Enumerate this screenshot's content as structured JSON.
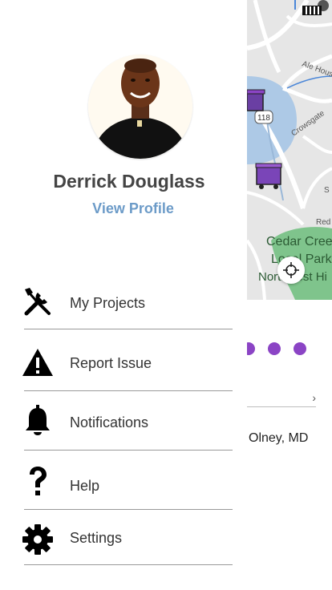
{
  "profile": {
    "name": "Derrick Douglass",
    "view_profile_label": "View Profile"
  },
  "menu": {
    "items": [
      {
        "label": "My Projects",
        "icon": "tools-icon"
      },
      {
        "label": "Report Issue",
        "icon": "warning-icon"
      },
      {
        "label": "Notifications",
        "icon": "bell-icon"
      },
      {
        "label": "Help",
        "icon": "question-icon"
      },
      {
        "label": "Settings",
        "icon": "gear-icon"
      }
    ]
  },
  "background": {
    "map_labels": [
      "Ale House",
      "Crowsgate",
      "Cedar Cree",
      "Local Park",
      "Northwest Hi",
      "Red",
      "Spring",
      "118"
    ],
    "location_text": "Olney, MD",
    "accent_color": "#8b44c5"
  }
}
